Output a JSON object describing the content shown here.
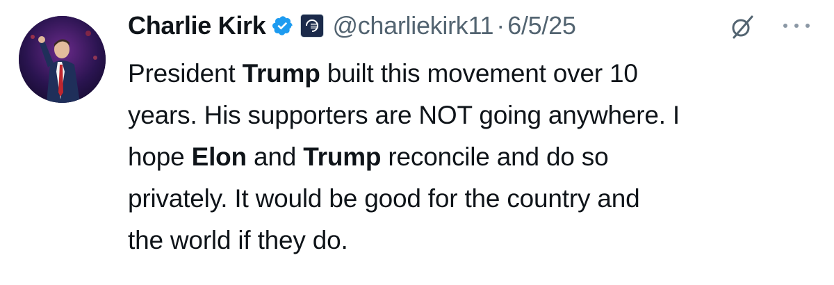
{
  "tweet": {
    "author": {
      "display_name": "Charlie Kirk",
      "handle": "@charliekirk11",
      "verified_icon": "verified-badge-icon",
      "affiliate_icon": "turning-point-usa-logo"
    },
    "separator": "·",
    "date": "6/5/25",
    "text": {
      "line1_pre": "President ",
      "line1_bold": "Trump",
      "line1_post": " built this movement over 10",
      "line2": "years. His supporters are NOT going anywhere. I",
      "line3_pre": "hope ",
      "line3_bold1": "Elon",
      "line3_mid": " and ",
      "line3_bold2": "Trump",
      "line3_post": " reconcile and do so",
      "line4": "privately. It would be good for the country and",
      "line5": "the world if they do."
    },
    "actions": {
      "grok_icon": "grok-icon",
      "more_icon": "more-icon"
    },
    "colors": {
      "text": "#0f1419",
      "secondary": "#536471",
      "verified": "#1d9bf0"
    }
  }
}
